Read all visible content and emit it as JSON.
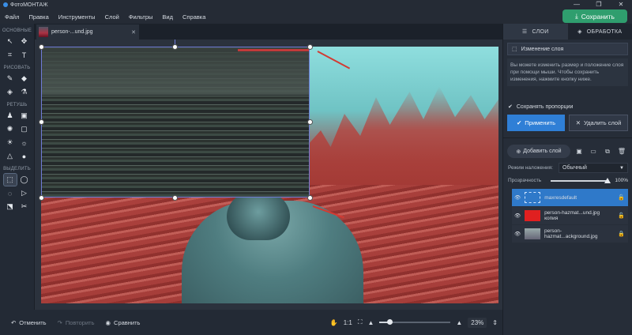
{
  "app": {
    "title": "ФотоМОНТАЖ"
  },
  "window_controls": [
    "—",
    "❐",
    "✕"
  ],
  "menu": [
    "Файл",
    "Правка",
    "Инструменты",
    "Слой",
    "Фильтры",
    "Вид",
    "Справка"
  ],
  "save_button": {
    "label": "Сохранить",
    "color": "#2f9e6e"
  },
  "tools": {
    "sections": [
      {
        "title": "ОСНОВНЫЕ",
        "items": [
          "↖",
          "✥",
          "⌗",
          "T"
        ]
      },
      {
        "title": "РИСОВАТЬ",
        "items": [
          "✎",
          "◆",
          "◈",
          "⚗"
        ]
      },
      {
        "title": "РЕТУШЬ",
        "items": [
          "♟",
          "▣",
          "✺",
          "▢",
          "☀",
          "☼",
          "△",
          "●"
        ]
      },
      {
        "title": "ВЫДЕЛИТЬ",
        "items": [
          "⬚",
          "◯",
          "◌",
          "▷",
          "⬔",
          "✂"
        ]
      }
    ]
  },
  "document_tab": {
    "name": "person-...und.jpg",
    "close": "✕"
  },
  "bottom": {
    "undo": "Отменить",
    "redo": "Повторить",
    "compare": "Сравнить",
    "ratio": "1:1",
    "zoom": "23%",
    "zoom_fraction": 0.14
  },
  "panel": {
    "tabs": [
      {
        "label": "СЛОИ",
        "active": true
      },
      {
        "label": "ОБРАБОТКА",
        "active": false
      }
    ],
    "mode_label": "Изменение слоя",
    "info_text": "Вы можете изменить размер и положение слоя при помощи мыши. Чтобы сохранить изменения, нажмите кнопку ниже.",
    "keep_proportions": "Сохранять пропорции",
    "apply": "Применить",
    "delete": "Удалить слой",
    "add_layer": "Добавить слой",
    "blend_label": "Режим наложения:",
    "blend_value": "Обычный",
    "opacity_label": "Прозрачность",
    "opacity_value": "100%",
    "layers": [
      {
        "name": "maxresdefault",
        "selected": true,
        "thumb_color": "#2f79c9"
      },
      {
        "name": "person-hazmat...und.jpg копия",
        "selected": false,
        "thumb_color": "#e02020"
      },
      {
        "name": "person-hazmat...ackground.jpg",
        "selected": false,
        "thumb_color": "#8a9a9a",
        "locked": true
      }
    ]
  }
}
